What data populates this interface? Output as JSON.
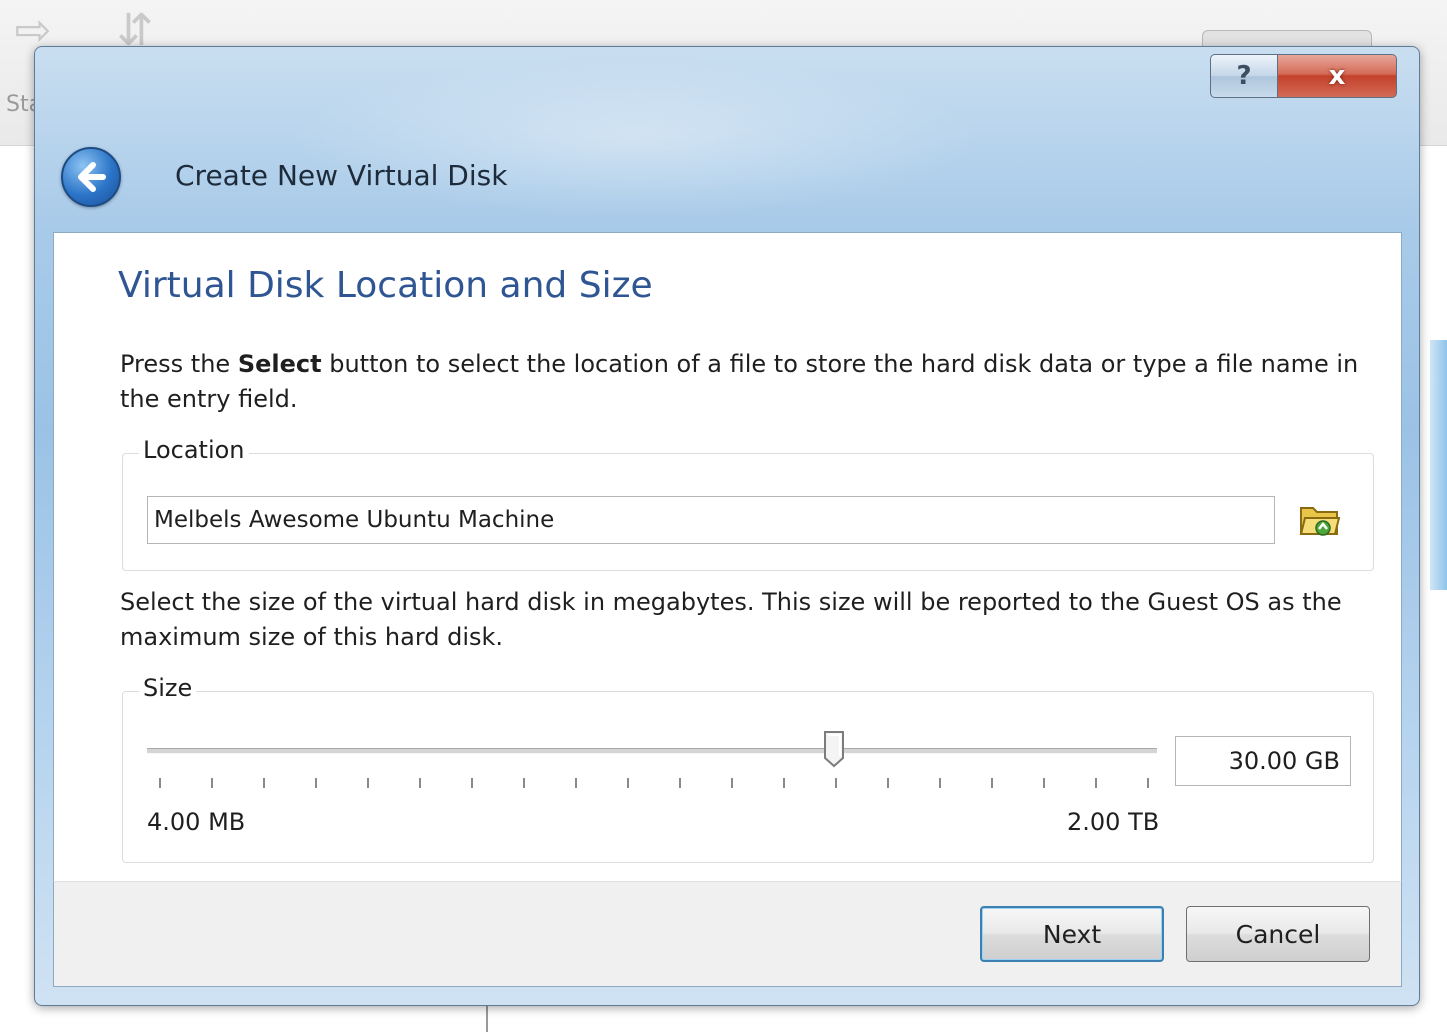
{
  "background": {
    "start_label": "Sta"
  },
  "window": {
    "title": "Create New Virtual Disk",
    "help_label": "?",
    "close_label": "x"
  },
  "page": {
    "heading": "Virtual Disk Location and Size",
    "location_desc_pre": "Press the ",
    "location_desc_bold": "Select",
    "location_desc_post": " button to select the location of a file to store the hard disk data or type a file name in the entry field.",
    "location_group_label": "Location",
    "location_value": "Melbels Awesome Ubuntu Machine",
    "size_desc": "Select the size of the virtual hard disk in megabytes. This size will be reported to the Guest OS as the maximum size of this hard disk.",
    "size_group_label": "Size",
    "size_min_label": "4.00 MB",
    "size_max_label": "2.00 TB",
    "size_value": "30.00 GB",
    "slider_fraction": 0.68
  },
  "footer": {
    "next_label": "Next",
    "cancel_label": "Cancel"
  },
  "icons": {
    "back": "back-arrow-icon",
    "folder": "folder-open-icon"
  }
}
